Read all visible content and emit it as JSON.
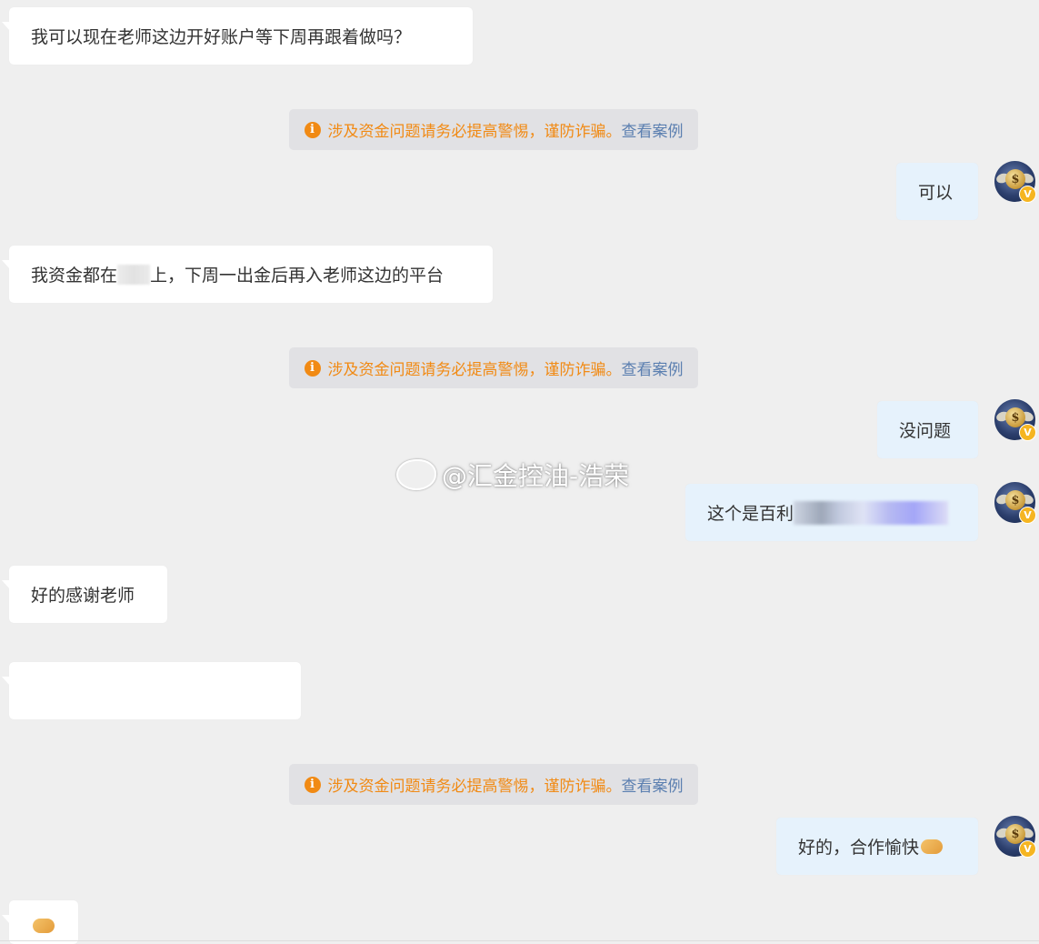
{
  "messages": {
    "m1": "我可以现在老师这边开好账户等下周再跟着做吗？",
    "m2": "可以",
    "m3_pre": "我资金都在",
    "m3_post": "上，下周一出金后再入老师这边的平台",
    "m4": "没问题",
    "m5": "这个是百利",
    "m6": "好的感谢老师",
    "m7": "",
    "m8": "好的，合作愉快"
  },
  "notice": {
    "icon": "info-icon",
    "warning": "涉及资金问题请务必提高警惕，谨防诈骗。",
    "link": "查看案例",
    "color": "#f18a14",
    "link_color": "#5b7fb0"
  },
  "watermark": {
    "text": "@汇金控油-浩荣",
    "icon": "weibo-logo-icon"
  },
  "avatar": {
    "icon": "coin-wings-avatar",
    "badge": "V"
  },
  "colors": {
    "background": "#efefef",
    "incoming_bubble": "#ffffff",
    "outgoing_bubble": "#e6f2fc"
  }
}
